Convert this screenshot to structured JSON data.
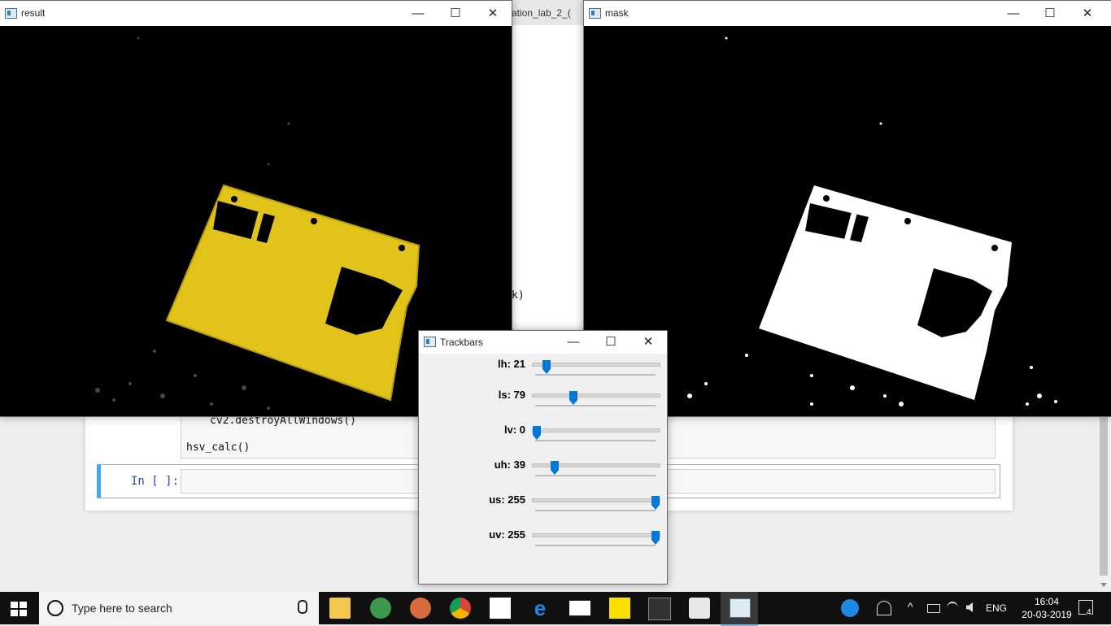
{
  "notebook": {
    "tab_partial": "ation_lab_2_(",
    "code_partial": "k)",
    "code_line_1": "cv2.destroyAllWindows()",
    "code_line_2": "hsv_calc()",
    "prompt": "In [ ]:"
  },
  "windows": {
    "result": {
      "title": "result"
    },
    "mask": {
      "title": "mask"
    }
  },
  "controls": {
    "minimize": "—",
    "maximize": "☐",
    "close": "✕"
  },
  "trackbars": {
    "title": "Trackbars",
    "max": 255,
    "items": [
      {
        "name": "lh",
        "label": "lh: 21",
        "value": 21
      },
      {
        "name": "ls",
        "label": "ls: 79",
        "value": 79
      },
      {
        "name": "lv",
        "label": "lv: 0",
        "value": 0
      },
      {
        "name": "uh",
        "label": "uh: 39",
        "value": 39
      },
      {
        "name": "us",
        "label": "us: 255",
        "value": 255
      },
      {
        "name": "uv",
        "label": "uv: 255",
        "value": 255
      }
    ]
  },
  "taskbar": {
    "search_placeholder": "Type here to search",
    "language": "ENG",
    "time": "16:04",
    "date": "20-03-2019",
    "notification_count": "4",
    "apps": [
      "file-explorer",
      "tripadvisor",
      "anaconda",
      "chrome",
      "store",
      "edge",
      "mail",
      "sticky-notes",
      "terminal",
      "paint",
      "opencv-window"
    ]
  }
}
